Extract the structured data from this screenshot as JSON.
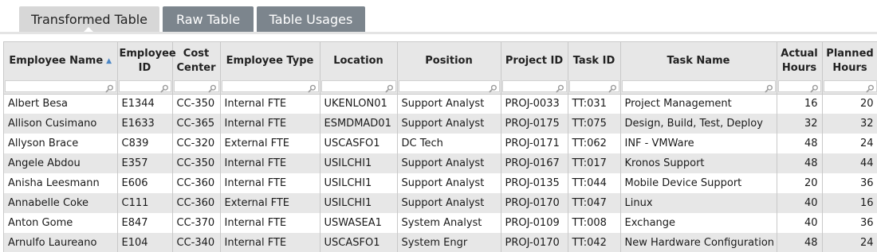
{
  "tabs": [
    {
      "label": "Transformed Table",
      "active": true
    },
    {
      "label": "Raw Table",
      "active": false
    },
    {
      "label": "Table Usages",
      "active": false
    }
  ],
  "columns": [
    {
      "key": "name",
      "label": "Employee Name",
      "sorted": "asc"
    },
    {
      "key": "emp_id",
      "label": "Employee ID"
    },
    {
      "key": "cost_center",
      "label": "Cost Center"
    },
    {
      "key": "emp_type",
      "label": "Employee Type"
    },
    {
      "key": "location",
      "label": "Location"
    },
    {
      "key": "position",
      "label": "Position"
    },
    {
      "key": "project_id",
      "label": "Project ID"
    },
    {
      "key": "task_id",
      "label": "Task ID"
    },
    {
      "key": "task_name",
      "label": "Task Name"
    },
    {
      "key": "actual_hours",
      "label": "Actual Hours"
    },
    {
      "key": "planned_hours",
      "label": "Planned Hours"
    }
  ],
  "rows": [
    [
      "Albert Besa",
      "E1344",
      "CC-350",
      "Internal FTE",
      "UKENLON01",
      "Support Analyst",
      "PROJ-0033",
      "TT:031",
      "Project Management",
      "16",
      "20"
    ],
    [
      "Allison Cusimano",
      "E1633",
      "CC-365",
      "Internal FTE",
      "ESMDMAD01",
      "Support Analyst",
      "PROJ-0175",
      "TT:075",
      "Design, Build, Test, Deploy",
      "32",
      "32"
    ],
    [
      "Allyson Brace",
      "C839",
      "CC-320",
      "External FTE",
      "USCASFO1",
      "DC Tech",
      "PROJ-0171",
      "TT:062",
      "INF - VMWare",
      "48",
      "24"
    ],
    [
      "Angele Abdou",
      "E357",
      "CC-350",
      "Internal FTE",
      "USILCHI1",
      "Support Analyst",
      "PROJ-0167",
      "TT:017",
      "Kronos Support",
      "48",
      "44"
    ],
    [
      "Anisha Leesmann",
      "E606",
      "CC-360",
      "Internal FTE",
      "USILCHI1",
      "Support Analyst",
      "PROJ-0135",
      "TT:044",
      "Mobile Device Support",
      "20",
      "36"
    ],
    [
      "Annabelle Coke",
      "C111",
      "CC-360",
      "External FTE",
      "USILCHI1",
      "Support Analyst",
      "PROJ-0170",
      "TT:047",
      "Linux",
      "40",
      "16"
    ],
    [
      "Anton Gome",
      "E847",
      "CC-370",
      "Internal FTE",
      "USWASEA1",
      "System Analyst",
      "PROJ-0109",
      "TT:008",
      "Exchange",
      "40",
      "36"
    ],
    [
      "Arnulfo Laureano",
      "E104",
      "CC-340",
      "Internal FTE",
      "USCASFO1",
      "System Engr",
      "PROJ-0170",
      "TT:042",
      "New Hardware Configuration",
      "48",
      "24"
    ]
  ],
  "icons": {
    "filter": "search-icon",
    "sort": "sort-ascending-icon"
  }
}
